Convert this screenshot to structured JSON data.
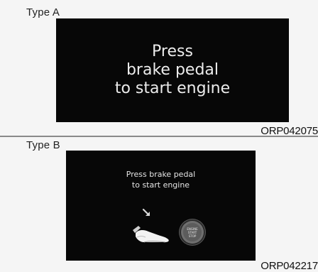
{
  "panel_a": {
    "type_label": "Type A",
    "message": "Press\nbrake pedal\nto start engine",
    "code": "ORP042075"
  },
  "panel_b": {
    "type_label": "Type B",
    "message": "Press brake pedal\nto start engine",
    "start_button_text": "ENGINE\nSTART\nSTOP",
    "icons": [
      "brake-pedal-foot-icon",
      "arrow-down-icon",
      "engine-start-stop-button-icon"
    ],
    "code": "ORP042217"
  }
}
